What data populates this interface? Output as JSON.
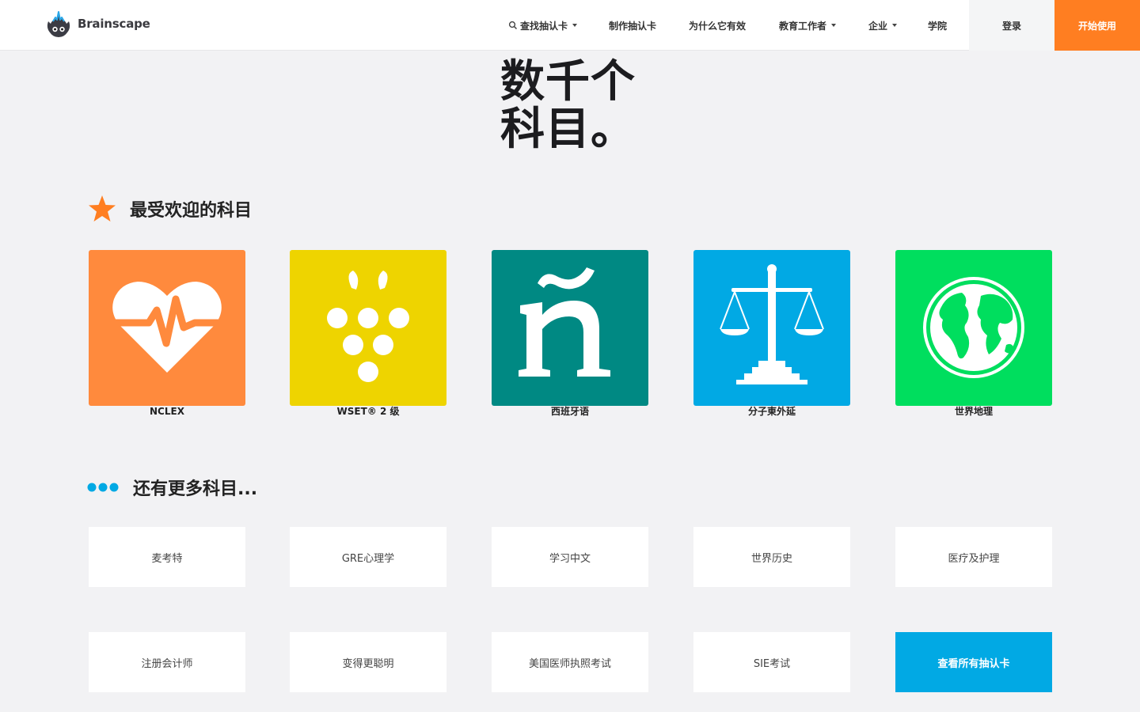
{
  "nav": {
    "brand": "Brainscape",
    "find_cards": "查找抽认卡",
    "make_cards": "制作抽认卡",
    "why": "为什么它有效",
    "educators": "教育工作者",
    "business": "企业",
    "academy": "学院",
    "login": "登录",
    "start": "开始使用"
  },
  "hero": {
    "line1": "数千个",
    "line2": "科目。"
  },
  "popular": {
    "heading": "最受欢迎的科目",
    "items": [
      {
        "label": "NCLEX",
        "color": "#ff8a3d",
        "icon": "heart-pulse-icon"
      },
      {
        "label": "WSET® 2 级",
        "color": "#eed400",
        "icon": "grapes-icon"
      },
      {
        "label": "西班牙语",
        "color": "#008983",
        "icon": "n-tilde-icon"
      },
      {
        "label": "分子東外延",
        "color": "#01a9e4",
        "icon": "scales-icon"
      },
      {
        "label": "世界地理",
        "color": "#00de5e",
        "icon": "globe-icon"
      }
    ]
  },
  "more": {
    "heading": "还有更多科目...",
    "items": [
      "麦考特",
      "GRE心理学",
      "学习中文",
      "世界历史",
      "医疗及护理",
      "注册会计师",
      "变得更聪明",
      "美国医师执照考试",
      "SIE考试"
    ],
    "view_all": "查看所有抽认卡"
  },
  "colors": {
    "accent_orange": "#ff7e21",
    "accent_blue": "#01a9e4"
  }
}
